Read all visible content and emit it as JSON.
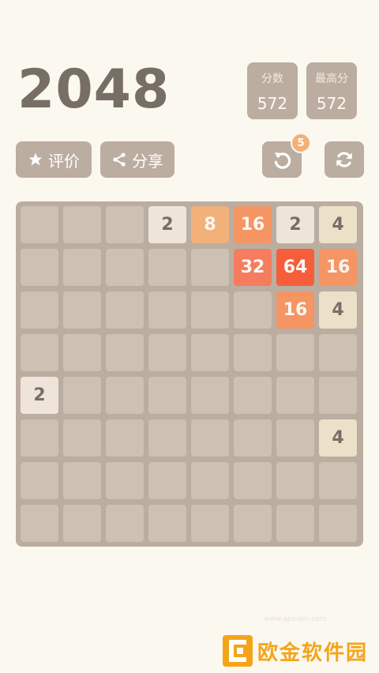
{
  "title": "2048",
  "score": {
    "label": "分数",
    "value": "572"
  },
  "best": {
    "label": "最高分",
    "value": "572"
  },
  "buttons": {
    "rate": "评价",
    "share": "分享"
  },
  "undo_count": "5",
  "board": [
    [
      "",
      "",
      "",
      "2",
      "8",
      "16",
      "2",
      "4"
    ],
    [
      "",
      "",
      "",
      "",
      "",
      "32",
      "64",
      "16"
    ],
    [
      "",
      "",
      "",
      "",
      "",
      "",
      "16",
      "4"
    ],
    [
      "",
      "",
      "",
      "",
      "",
      "",
      "",
      ""
    ],
    [
      "2",
      "",
      "",
      "",
      "",
      "",
      "",
      ""
    ],
    [
      "",
      "",
      "",
      "",
      "",
      "",
      "",
      "4"
    ],
    [
      "",
      "",
      "",
      "",
      "",
      "",
      "",
      ""
    ],
    [
      "",
      "",
      "",
      "",
      "",
      "",
      "",
      ""
    ]
  ],
  "watermark": {
    "text": "欧金软件园",
    "url": "www.apoujin.com"
  }
}
